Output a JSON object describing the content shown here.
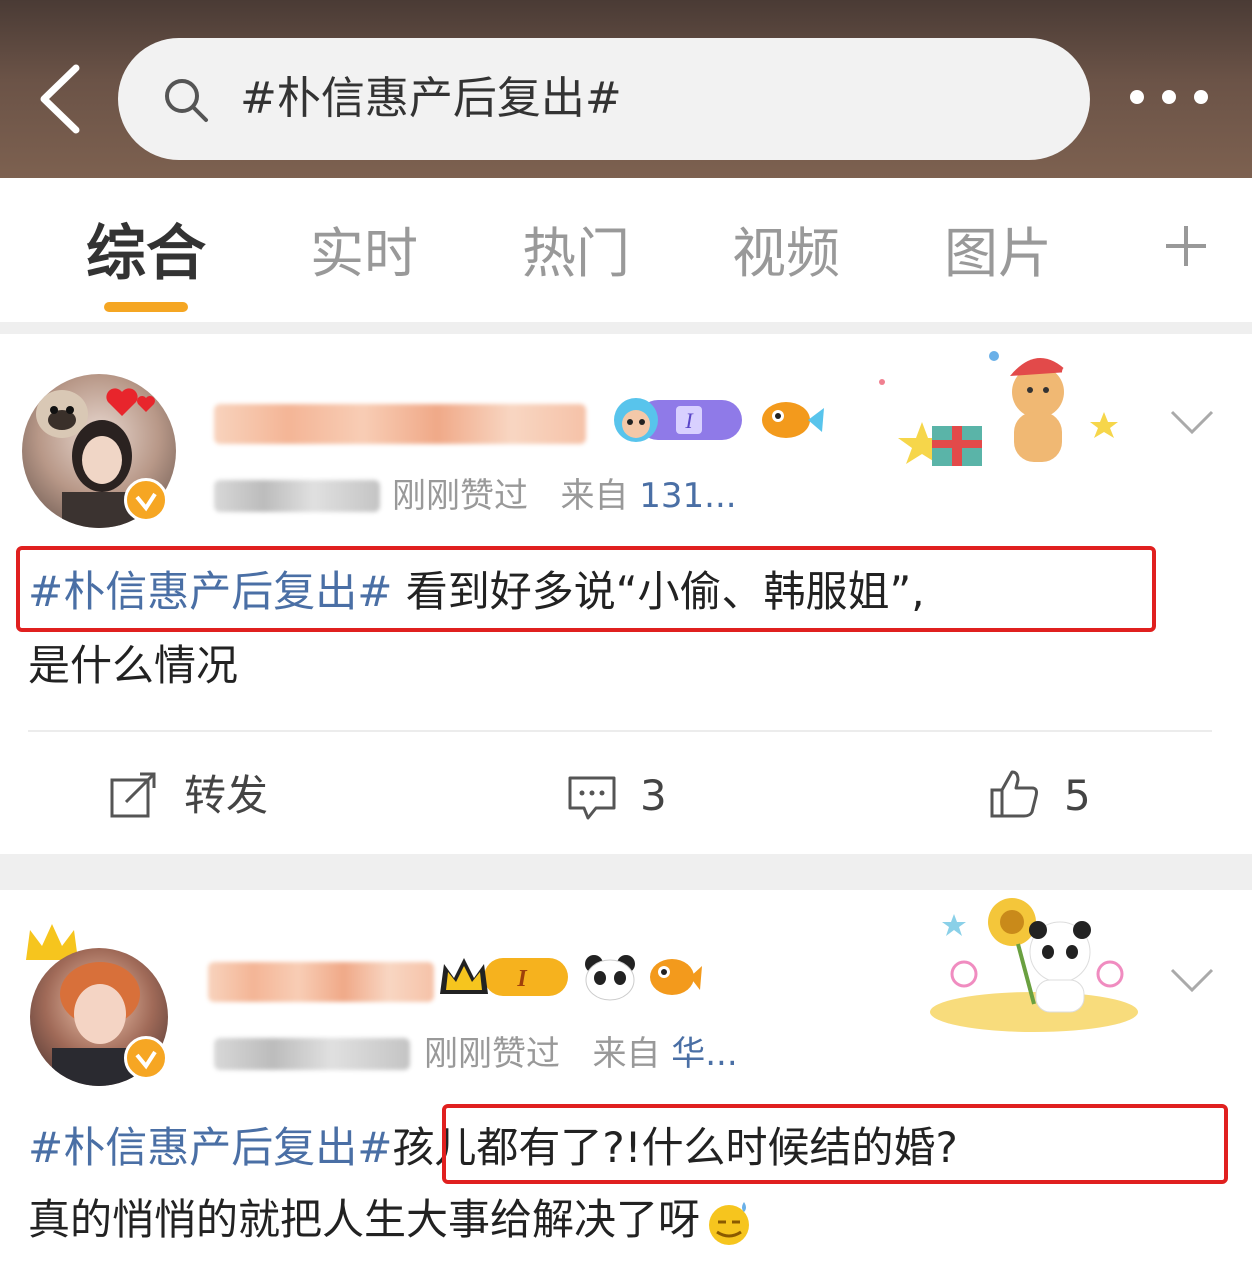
{
  "search": {
    "query": "#朴信惠产后复出#"
  },
  "tabs": [
    {
      "label": "综合",
      "active": true
    },
    {
      "label": "实时",
      "active": false
    },
    {
      "label": "热门",
      "active": false
    },
    {
      "label": "视频",
      "active": false
    },
    {
      "label": "图片",
      "active": false
    }
  ],
  "colors": {
    "accent": "#f5a623",
    "link": "#4a6fa5",
    "highlight_box": "#e0201f"
  },
  "posts": [
    {
      "meta_liked": "刚刚赞过",
      "meta_from": "来自",
      "meta_source": "131...",
      "hashtag": "#朴信惠产后复出#",
      "text_boxed": " 看到好多说“小偷、韩服姐”,",
      "text_line2": "是什么情况",
      "actions": {
        "repost_label": "转发",
        "comments": "3",
        "likes": "5"
      }
    },
    {
      "meta_liked": "刚刚赞过",
      "meta_from": "来自",
      "meta_source": "华...",
      "hashtag": "#朴信惠产后复出#",
      "text_boxed": "孩儿都有了?!什么时候结的婚?",
      "text_line2": "真的悄悄的就把人生大事给解决了呀"
    }
  ]
}
